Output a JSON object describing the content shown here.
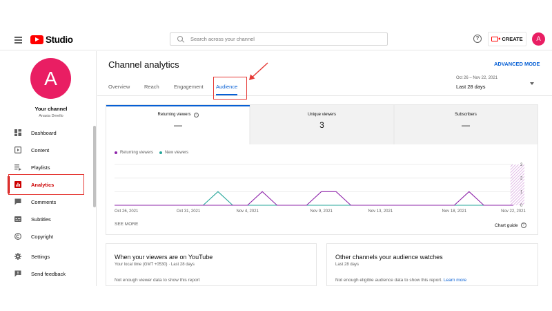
{
  "app": {
    "title": "Studio"
  },
  "search": {
    "placeholder": "Search across your channel"
  },
  "header": {
    "create_label": "CREATE",
    "avatar_letter": "A",
    "help_glyph": "?"
  },
  "sidebar": {
    "avatar_letter": "A",
    "channel_label": "Your channel",
    "channel_name": "Anasia Dmello",
    "items": [
      {
        "label": "Dashboard",
        "icon": "dashboard-icon",
        "active": false
      },
      {
        "label": "Content",
        "icon": "content-icon",
        "active": false
      },
      {
        "label": "Playlists",
        "icon": "playlists-icon",
        "active": false
      },
      {
        "label": "Analytics",
        "icon": "analytics-icon",
        "active": true
      },
      {
        "label": "Comments",
        "icon": "comments-icon",
        "active": false
      },
      {
        "label": "Subtitles",
        "icon": "subtitles-icon",
        "active": false
      },
      {
        "label": "Copyright",
        "icon": "copyright-icon",
        "active": false
      },
      {
        "label": "Settings",
        "icon": "settings-icon",
        "active": false
      },
      {
        "label": "Send feedback",
        "icon": "feedback-icon",
        "active": false
      }
    ]
  },
  "main": {
    "title": "Channel analytics",
    "advanced_mode": "ADVANCED MODE",
    "tabs": [
      {
        "label": "Overview",
        "active": false
      },
      {
        "label": "Reach",
        "active": false
      },
      {
        "label": "Engagement",
        "active": false
      },
      {
        "label": "Audience",
        "active": true
      }
    ],
    "date_range": "Oct 26 – Nov 22, 2021",
    "date_period": "Last 28 days"
  },
  "metrics": [
    {
      "label": "Returning viewers",
      "value": "—",
      "has_info": true,
      "selected": true
    },
    {
      "label": "Unique viewers",
      "value": "3",
      "has_info": false,
      "selected": false
    },
    {
      "label": "Subscribers",
      "value": "—",
      "has_info": false,
      "selected": false
    }
  ],
  "chart_data": {
    "type": "line",
    "x": [
      "Oct 26",
      "Oct 27",
      "Oct 28",
      "Oct 29",
      "Oct 30",
      "Oct 31",
      "Nov 1",
      "Nov 2",
      "Nov 3",
      "Nov 4",
      "Nov 5",
      "Nov 6",
      "Nov 7",
      "Nov 8",
      "Nov 9",
      "Nov 10",
      "Nov 11",
      "Nov 12",
      "Nov 13",
      "Nov 14",
      "Nov 15",
      "Nov 16",
      "Nov 17",
      "Nov 18",
      "Nov 19",
      "Nov 20",
      "Nov 21",
      "Nov 22"
    ],
    "series": [
      {
        "name": "Returning viewers",
        "color": "#8e24aa",
        "values": [
          0,
          0,
          0,
          0,
          0,
          0,
          0,
          0,
          0,
          0,
          1,
          0,
          0,
          0,
          1,
          1,
          0,
          0,
          0,
          0,
          0,
          0,
          0,
          0,
          1,
          0,
          0,
          0
        ]
      },
      {
        "name": "New viewers",
        "color": "#26a69a",
        "values": [
          0,
          0,
          0,
          0,
          0,
          0,
          0,
          1,
          0,
          0,
          0,
          0,
          0,
          0,
          0,
          0,
          0,
          0,
          0,
          0,
          0,
          0,
          0,
          0,
          0,
          0,
          0,
          0
        ]
      }
    ],
    "xtick_labels": [
      "Oct 26, 2021",
      "Oct 31, 2021",
      "Nov 4, 2021",
      "Nov 9, 2021",
      "Nov 13, 2021",
      "Nov 18, 2021",
      "Nov 22, 2021"
    ],
    "ytick_labels": [
      "0",
      "1",
      "2",
      "3"
    ],
    "ylim": [
      0,
      3
    ],
    "grid": true,
    "legend": "top-left",
    "partial_last_period": true
  },
  "chart_footer": {
    "see_more": "SEE MORE",
    "chart_guide": "Chart guide",
    "help_glyph": "?"
  },
  "bottom_cards": [
    {
      "title": "When your viewers are on YouTube",
      "subtitle": "Your local time (GMT +0530) · Last 28 days",
      "message": "Not enough viewer data to show this report",
      "link": ""
    },
    {
      "title": "Other channels your audience watches",
      "subtitle": "Last 28 days",
      "message": "Not enough eligible audience data to show this report.",
      "link": "Learn more"
    }
  ],
  "colors": {
    "accent": "#065fd4",
    "brand": "#ff0000",
    "active_nav": "#cc0000",
    "avatar": "#e91e63",
    "highlight": "#e53935"
  }
}
